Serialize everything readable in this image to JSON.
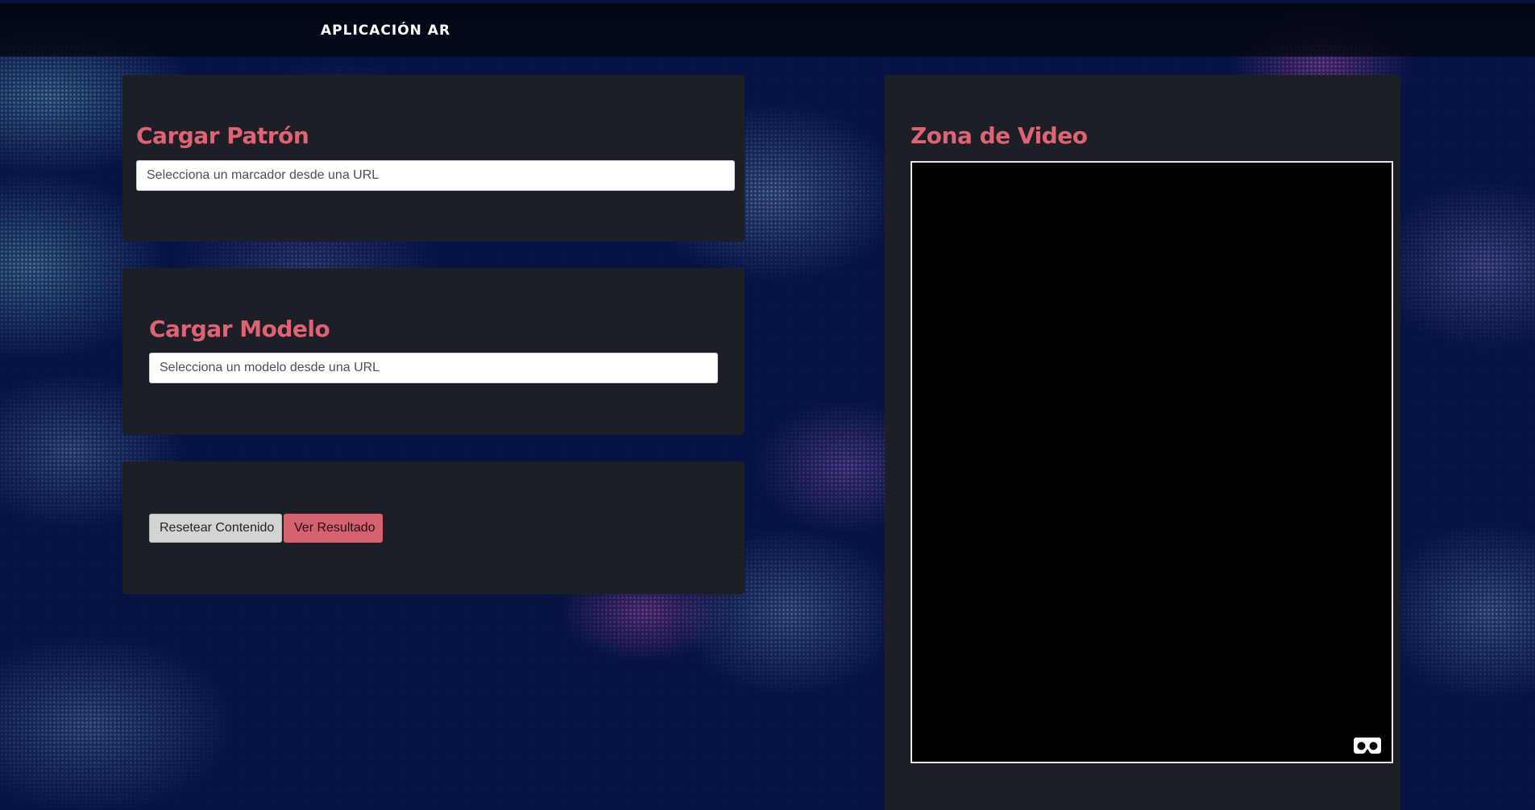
{
  "navbar": {
    "brand": "APLICACIÓN AR"
  },
  "patron_card": {
    "title": "Cargar Patrón",
    "input_placeholder": "Selecciona un marcador desde una URL",
    "input_value": ""
  },
  "modelo_card": {
    "title": "Cargar Modelo",
    "input_placeholder": "Selecciona un modelo desde una URL",
    "input_value": ""
  },
  "actions": {
    "reset_label": "Resetear Contenido",
    "result_label": "Ver Resultado"
  },
  "video_card": {
    "title": "Zona de Video",
    "vr_icon": "vr-headset-icon"
  },
  "colors": {
    "accent": "#de6474",
    "card_bg": "#1c1f26",
    "navbar_bg": "#02060f",
    "page_bg": "#061447",
    "reset_button": "#d4d4d4",
    "result_button": "#d6626f"
  }
}
